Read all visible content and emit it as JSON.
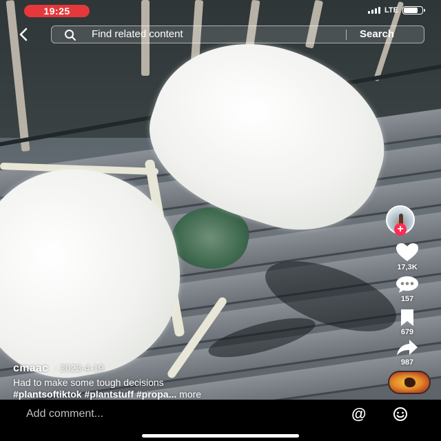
{
  "status_bar": {
    "time": "19:25",
    "network": "LTE",
    "battery_level": 0.85
  },
  "search": {
    "placeholder": "Find related content",
    "button_label": "Search"
  },
  "actions": {
    "likes": "17,3K",
    "comments": "157",
    "saves": "679",
    "shares": "987"
  },
  "post": {
    "username": "cmaac",
    "separator": "·",
    "date": "2023-4-19",
    "caption": "Had to make some tough decisions",
    "hashtags": "#plantsoftiktok #plantstuff #propa...",
    "more_label": "more"
  },
  "comment_bar": {
    "placeholder": "Add comment...",
    "mention_symbol": "@"
  },
  "icons": {
    "back": "chevron-left-icon",
    "search": "magnifier-icon",
    "like": "heart-icon",
    "comment": "speech-bubble-icon",
    "save": "bookmark-icon",
    "share": "share-arrow-icon",
    "emoji": "smiley-icon"
  },
  "colors": {
    "time_pill": "#e5383b",
    "follow_badge": "#fe2c55"
  }
}
